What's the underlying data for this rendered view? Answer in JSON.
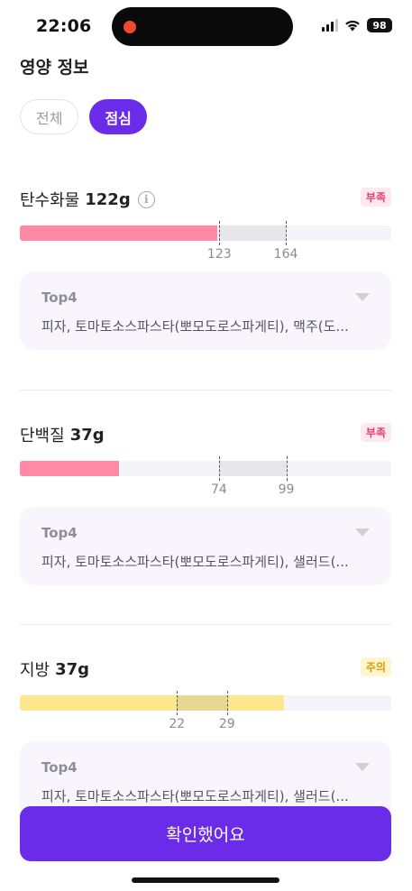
{
  "status_bar": {
    "time": "22:06",
    "battery": "98"
  },
  "section_title": "영양 정보",
  "filters": [
    {
      "label": "전체",
      "selected": false
    },
    {
      "label": "점심",
      "selected": true
    }
  ],
  "nutrients": [
    {
      "name": "탄수화물",
      "amount": "122g",
      "badge": "부족",
      "status": "low",
      "fill_color": "#ff8aa6",
      "range_color": "#e7e6ec",
      "value": 122,
      "min": 123,
      "max": 164,
      "scale_max": 229,
      "min_label": "123",
      "max_label": "164",
      "top_title": "Top4",
      "top_items": "피자, 토마토소스파스타(뽀모도로스파게티), 맥주(도..."
    },
    {
      "name": "단백질",
      "amount": "37g",
      "badge": "부족",
      "status": "low",
      "fill_color": "#ff8aa6",
      "range_color": "#e7e6ec",
      "value": 37,
      "min": 74,
      "max": 99,
      "scale_max": 138,
      "min_label": "74",
      "max_label": "99",
      "top_title": "Top4",
      "top_items": "피자, 토마토소스파스타(뽀모도로스파게티), 샐러드(..."
    },
    {
      "name": "지방",
      "amount": "37g",
      "badge": "주의",
      "status": "warn",
      "fill_color": "#fce78e",
      "range_color": "#e8d792",
      "value": 37,
      "min": 22,
      "max": 29,
      "scale_max": 52,
      "min_label": "22",
      "max_label": "29",
      "top_title": "Top4",
      "top_items": "피자, 토마토소스파스타(뽀모도로스파게티), 샐러드(..."
    }
  ],
  "confirm_label": "확인했어요"
}
